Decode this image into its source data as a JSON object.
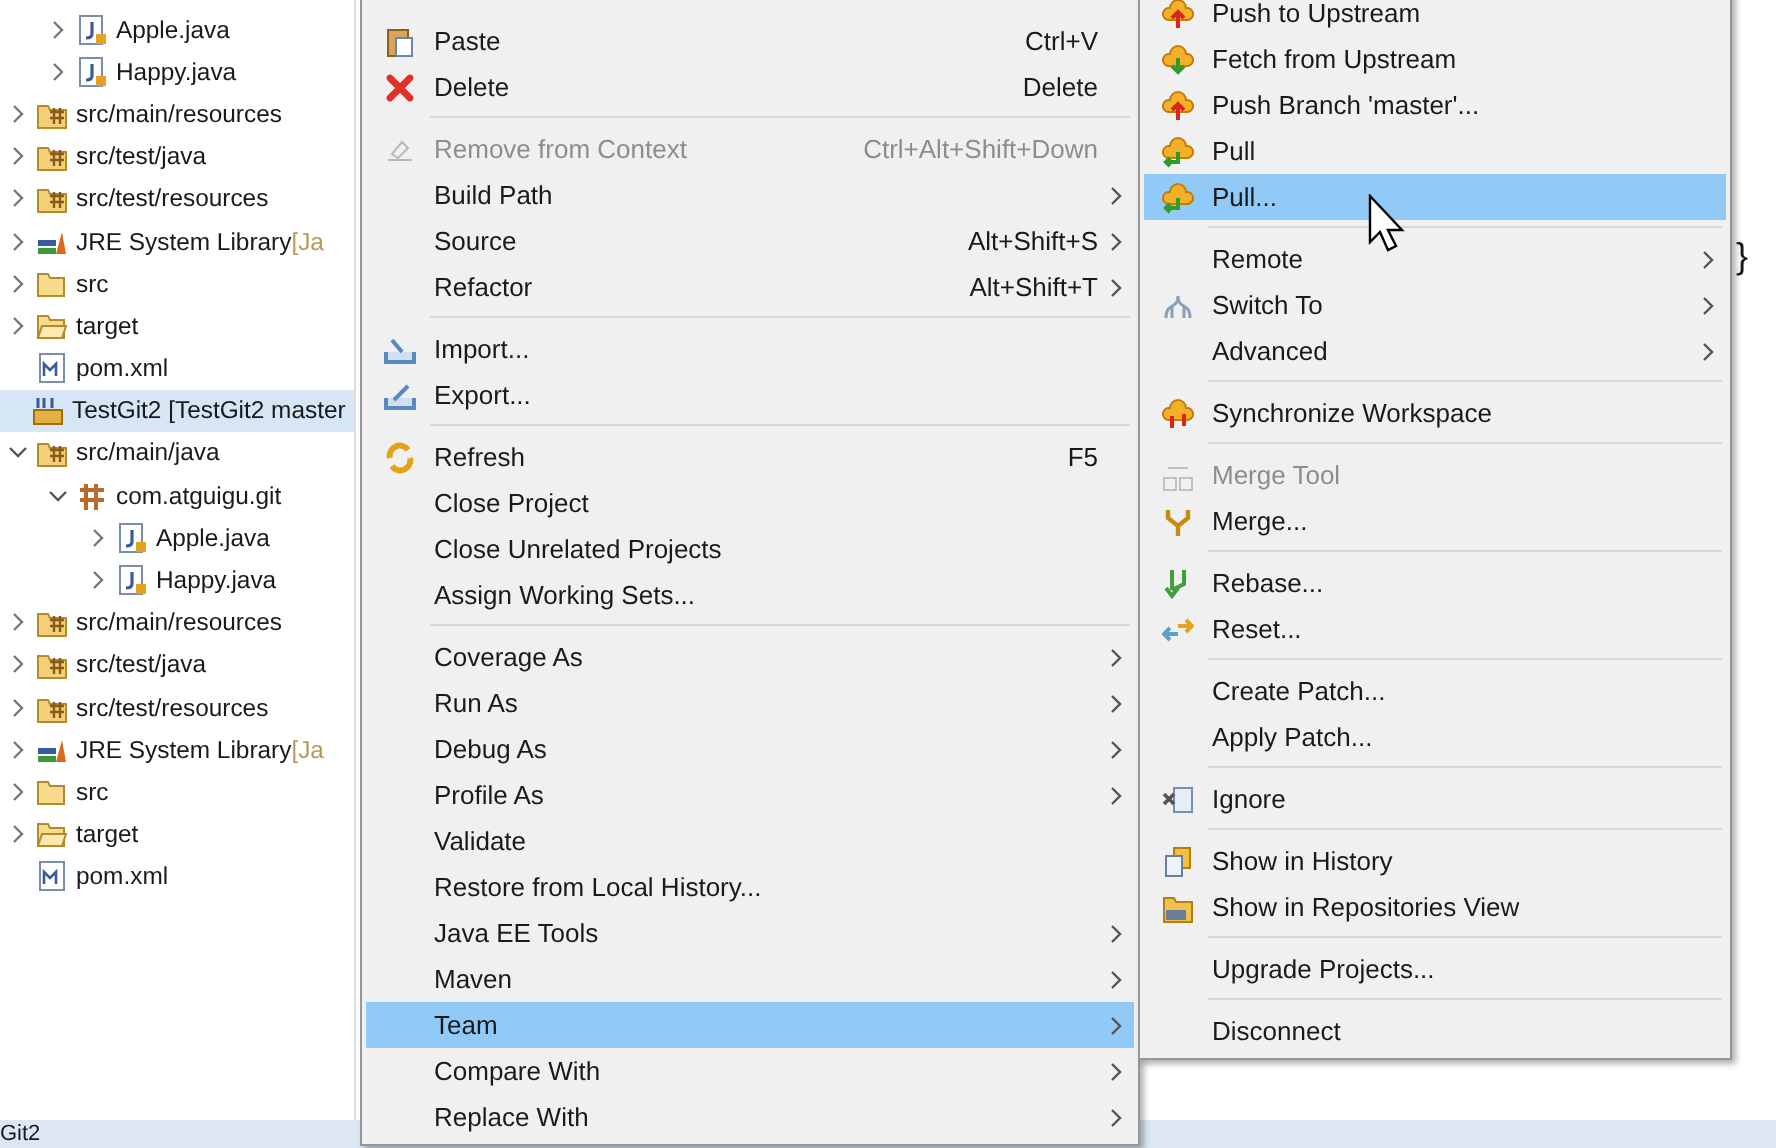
{
  "tree": {
    "items": [
      {
        "children": [
          {
            "children": [
              {
                "label": "Apple.java",
                "kind": "java",
                "expanded": false,
                "selected": false
              },
              {
                "label": "Happy.java",
                "kind": "java",
                "expanded": false,
                "selected": false
              }
            ]
          },
          {
            "label": "src/main/resources",
            "kind": "source-folder",
            "expanded": false,
            "selected": false
          },
          {
            "label": "src/test/java",
            "kind": "source-folder",
            "expanded": false,
            "selected": false
          },
          {
            "label": "src/test/resources",
            "kind": "source-folder",
            "expanded": false,
            "selected": false
          },
          {
            "label": "JRE System Library",
            "suffix": "[Ja",
            "kind": "library",
            "expanded": false,
            "selected": false
          },
          {
            "label": "src",
            "kind": "folder",
            "expanded": false,
            "selected": false
          },
          {
            "label": "target",
            "kind": "folder-open",
            "expanded": false,
            "selected": false
          },
          {
            "label": "pom.xml",
            "kind": "xml",
            "selected": false
          }
        ]
      },
      {
        "label": "TestGit2 [TestGit2 master",
        "kind": "project",
        "selected": true,
        "children": [
          {
            "label": "src/main/java",
            "kind": "source-folder",
            "expanded": true,
            "selected": false,
            "children": [
              {
                "label": "com.atguigu.git",
                "kind": "package",
                "expanded": true,
                "selected": false,
                "children": [
                  {
                    "label": "Apple.java",
                    "kind": "java",
                    "expanded": false,
                    "selected": false
                  },
                  {
                    "label": "Happy.java",
                    "kind": "java",
                    "expanded": false,
                    "selected": false
                  }
                ]
              }
            ]
          },
          {
            "label": "src/main/resources",
            "kind": "source-folder",
            "expanded": false,
            "selected": false
          },
          {
            "label": "src/test/java",
            "kind": "source-folder",
            "expanded": false,
            "selected": false
          },
          {
            "label": "src/test/resources",
            "kind": "source-folder",
            "expanded": false,
            "selected": false
          },
          {
            "label": "JRE System Library",
            "suffix": "[Ja",
            "kind": "library",
            "expanded": false,
            "selected": false
          },
          {
            "label": "src",
            "kind": "folder",
            "expanded": false,
            "selected": false
          },
          {
            "label": "target",
            "kind": "folder-open",
            "expanded": false,
            "selected": false
          },
          {
            "label": "pom.xml",
            "kind": "xml",
            "selected": false
          }
        ]
      }
    ]
  },
  "context_menu": {
    "items": [
      {
        "kind": "item",
        "label": "Paste",
        "shortcut": "Ctrl+V",
        "selected": false
      },
      {
        "kind": "item",
        "label": "Delete",
        "shortcut": "Delete",
        "selected": false
      },
      {
        "kind": "separator"
      },
      {
        "kind": "item",
        "label": "Remove from Context",
        "shortcut": "Ctrl+Alt+Shift+Down",
        "disabled": true,
        "selected": false
      },
      {
        "kind": "item",
        "label": "Build Path",
        "submenu": true,
        "selected": false
      },
      {
        "kind": "item",
        "label": "Source",
        "shortcut": "Alt+Shift+S",
        "submenu": true,
        "selected": false
      },
      {
        "kind": "item",
        "label": "Refactor",
        "shortcut": "Alt+Shift+T",
        "submenu": true,
        "selected": false
      },
      {
        "kind": "separator"
      },
      {
        "kind": "item",
        "label": "Import...",
        "selected": false
      },
      {
        "kind": "item",
        "label": "Export...",
        "selected": false
      },
      {
        "kind": "separator"
      },
      {
        "kind": "item",
        "label": "Refresh",
        "shortcut": "F5",
        "selected": false
      },
      {
        "kind": "item",
        "label": "Close Project",
        "selected": false
      },
      {
        "kind": "item",
        "label": "Close Unrelated Projects",
        "selected": false
      },
      {
        "kind": "item",
        "label": "Assign Working Sets...",
        "selected": false
      },
      {
        "kind": "separator"
      },
      {
        "kind": "item",
        "label": "Coverage As",
        "submenu": true,
        "selected": false
      },
      {
        "kind": "item",
        "label": "Run As",
        "submenu": true,
        "selected": false
      },
      {
        "kind": "item",
        "label": "Debug As",
        "submenu": true,
        "selected": false
      },
      {
        "kind": "item",
        "label": "Profile As",
        "submenu": true,
        "selected": false
      },
      {
        "kind": "item",
        "label": "Validate",
        "selected": false
      },
      {
        "kind": "item",
        "label": "Restore from Local History...",
        "selected": false
      },
      {
        "kind": "item",
        "label": "Java EE Tools",
        "submenu": true,
        "selected": false
      },
      {
        "kind": "item",
        "label": "Maven",
        "submenu": true,
        "selected": false
      },
      {
        "kind": "item",
        "label": "Team",
        "submenu": true,
        "selected": true
      },
      {
        "kind": "item",
        "label": "Compare With",
        "submenu": true,
        "selected": false
      },
      {
        "kind": "item",
        "label": "Replace With",
        "submenu": true,
        "selected": false
      }
    ]
  },
  "team_menu": {
    "items": [
      {
        "kind": "item",
        "label": "Push to Upstream",
        "selected": false
      },
      {
        "kind": "item",
        "label": "Fetch from Upstream",
        "selected": false
      },
      {
        "kind": "item",
        "label": "Push Branch 'master'...",
        "selected": false
      },
      {
        "kind": "item",
        "label": "Pull",
        "selected": false
      },
      {
        "kind": "item",
        "label": "Pull...",
        "selected": true
      },
      {
        "kind": "separator"
      },
      {
        "kind": "item",
        "label": "Remote",
        "submenu": true,
        "selected": false
      },
      {
        "kind": "item",
        "label": "Switch To",
        "submenu": true,
        "selected": false
      },
      {
        "kind": "item",
        "label": "Advanced",
        "submenu": true,
        "selected": false
      },
      {
        "kind": "separator"
      },
      {
        "kind": "item",
        "label": "Synchronize Workspace",
        "selected": false
      },
      {
        "kind": "separator"
      },
      {
        "kind": "item",
        "label": "Merge Tool",
        "disabled": true,
        "selected": false
      },
      {
        "kind": "item",
        "label": "Merge...",
        "selected": false
      },
      {
        "kind": "separator"
      },
      {
        "kind": "item",
        "label": "Rebase...",
        "selected": false
      },
      {
        "kind": "item",
        "label": "Reset...",
        "selected": false
      },
      {
        "kind": "separator"
      },
      {
        "kind": "item",
        "label": "Create Patch...",
        "selected": false
      },
      {
        "kind": "item",
        "label": "Apply Patch...",
        "selected": false
      },
      {
        "kind": "separator"
      },
      {
        "kind": "item",
        "label": "Ignore",
        "selected": false
      },
      {
        "kind": "separator"
      },
      {
        "kind": "item",
        "label": "Show in History",
        "selected": false
      },
      {
        "kind": "item",
        "label": "Show in Repositories View",
        "selected": false
      },
      {
        "kind": "separator"
      },
      {
        "kind": "item",
        "label": "Upgrade Projects...",
        "selected": false
      },
      {
        "kind": "separator"
      },
      {
        "kind": "item",
        "label": "Disconnect",
        "selected": false
      }
    ]
  },
  "editor": {
    "text": "}"
  },
  "status_bar": {
    "text": "Git2"
  }
}
